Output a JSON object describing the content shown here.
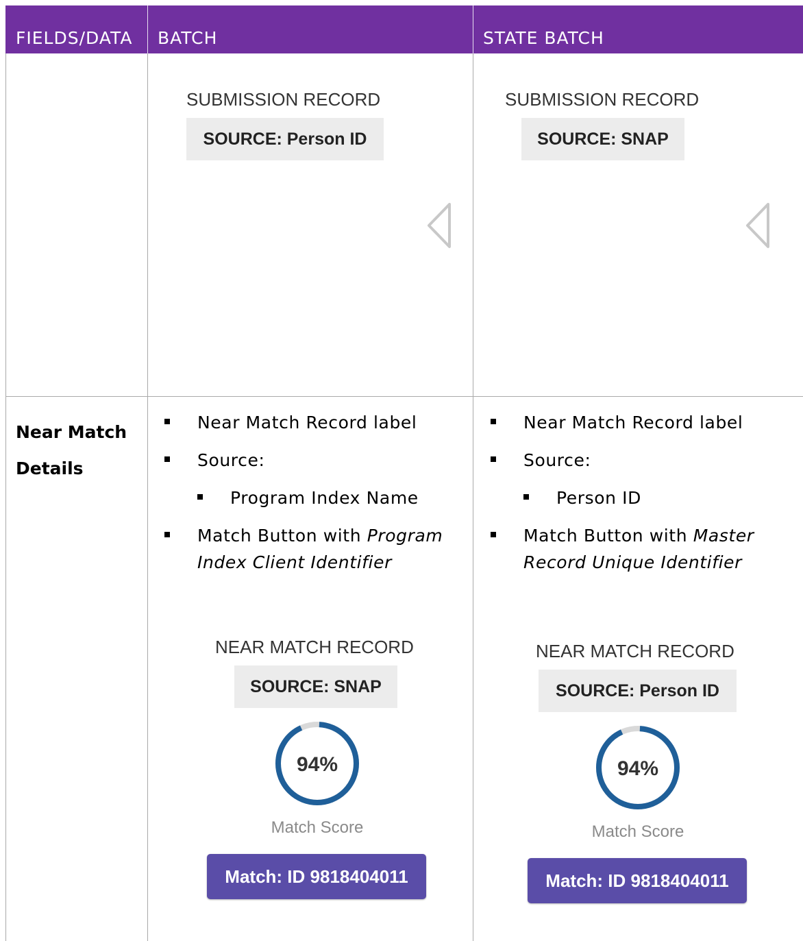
{
  "header": {
    "col1": "FIELDS/DATA",
    "col2": "BATCH",
    "col3": "STATE BATCH"
  },
  "row1": {
    "batch": {
      "submission_label": "SUBMISSION RECORD",
      "source": "SOURCE: Person ID"
    },
    "state_batch": {
      "submission_label": "SUBMISSION RECORD",
      "source": "SOURCE: SNAP"
    }
  },
  "row2": {
    "label_line1": "Near Match",
    "label_line2": "Details",
    "batch": {
      "bullet1": "Near Match Record label",
      "bullet2": "Source:",
      "sub_bullet": "Program Index Name",
      "bullet3_prefix": "Match Button with ",
      "bullet3_em1": "Program",
      "bullet3_em2": "Index Client Identifier",
      "near_match_label": "NEAR MATCH RECORD",
      "source": "SOURCE: SNAP",
      "score": "94%",
      "score_value": 0.94,
      "score_label": "Match Score",
      "match_button": "Match: ID 9818404011"
    },
    "state_batch": {
      "bullet1": "Near Match Record label",
      "bullet2": "Source:",
      "sub_bullet": "Person ID",
      "bullet3_prefix": "Match Button with ",
      "bullet3_em1": "Master",
      "bullet3_em2": "Record Unique Identifier",
      "near_match_label": "NEAR MATCH RECORD",
      "source": "SOURCE: Person ID",
      "score": "94%",
      "score_value": 0.94,
      "score_label": "Match Score",
      "match_button": "Match: ID 9818404011"
    }
  },
  "colors": {
    "header_bg": "#7030a0",
    "gauge_ring": "#1f5f99",
    "gauge_track": "#d9d9d9",
    "match_button_bg": "#5a4da8"
  }
}
